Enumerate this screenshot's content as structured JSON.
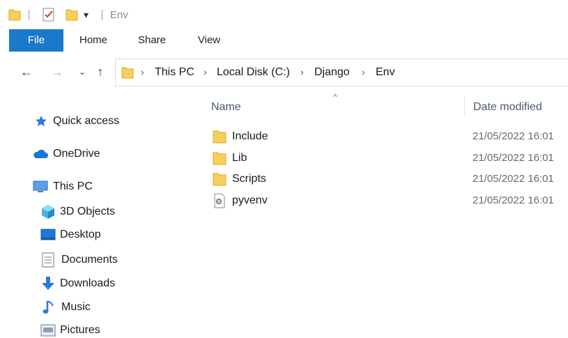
{
  "window": {
    "title": "Env"
  },
  "ribbon": {
    "tabs": [
      "File",
      "Home",
      "Share",
      "View"
    ]
  },
  "address": {
    "crumbs": [
      "This PC",
      "Local Disk (C:)",
      "Django",
      "Env"
    ]
  },
  "nav": {
    "quick_access": "Quick access",
    "onedrive": "OneDrive",
    "this_pc": "This PC",
    "children": [
      "3D Objects",
      "Desktop",
      "Documents",
      "Downloads",
      "Music",
      "Pictures"
    ]
  },
  "list": {
    "columns": {
      "name": "Name",
      "date": "Date modified"
    },
    "files": [
      {
        "name": "Include",
        "date": "21/05/2022 16:01",
        "icon": "folder-icon"
      },
      {
        "name": "Lib",
        "date": "21/05/2022 16:01",
        "icon": "folder-icon"
      },
      {
        "name": "Scripts",
        "date": "21/05/2022 16:01",
        "icon": "folder-icon"
      },
      {
        "name": "pyvenv",
        "date": "21/05/2022 16:01",
        "icon": "config-file-icon"
      }
    ]
  },
  "colors": {
    "accent": "#1979ca",
    "folder": "#f5c542"
  }
}
